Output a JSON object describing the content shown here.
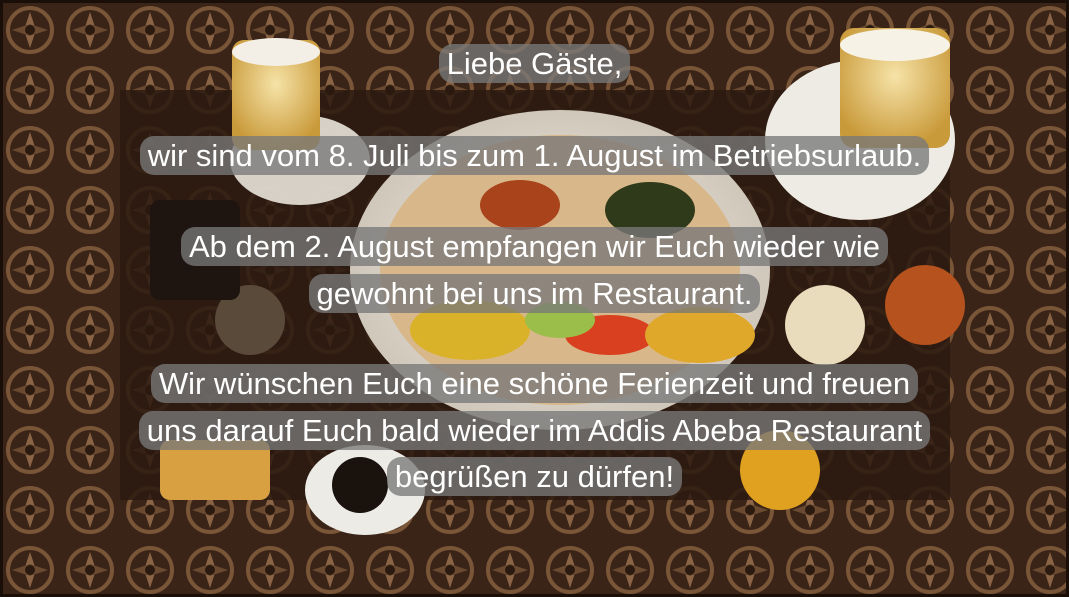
{
  "notice": {
    "greeting": "Liebe Gäste,",
    "closure": "wir sind vom 8. Juli bis zum 1. August im Betriebsurlaub.",
    "reopen_line1": "Ab dem 2. August empfangen wir Euch wieder wie",
    "reopen_line2": "gewohnt bei uns im Restaurant.",
    "wish_line1": "Wir wünschen Euch eine schöne Ferienzeit und freuen",
    "wish_line2": "uns darauf Euch bald wieder im Addis Abeba Restaurant",
    "wish_line3": "begrüßen zu dürfen!"
  },
  "colors": {
    "text": "#ffffff",
    "text_box": "#787878",
    "table_wood": "#3b2416",
    "carving": "#6e4a33"
  }
}
